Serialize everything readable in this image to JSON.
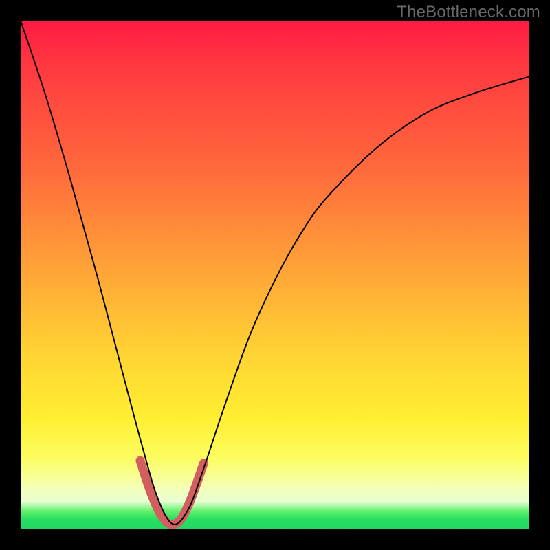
{
  "watermark": "TheBottleneck.com",
  "colors": {
    "frame": "#000000",
    "gradient_top": "#ff1a43",
    "gradient_mid": "#ffd233",
    "gradient_bottom": "#21d863",
    "curve": "#000000",
    "marker": "#d25e60",
    "watermark_text": "#67696a"
  },
  "chart_data": {
    "type": "line",
    "title": "",
    "xlabel": "",
    "ylabel": "",
    "xlim": [
      0,
      1
    ],
    "ylim": [
      0,
      1
    ],
    "notes": "V-shaped bottleneck curve over a vertical red-to-green gradient. x and y are normalized fractions of plot width/height (origin bottom-left). Minimum (optimal point) near x≈0.30 where curve touches y≈0.01. Highlighted marker band near the trough.",
    "series": [
      {
        "name": "bottleneck_curve",
        "x": [
          0.0,
          0.05,
          0.1,
          0.15,
          0.2,
          0.24,
          0.27,
          0.3,
          0.33,
          0.36,
          0.4,
          0.45,
          0.5,
          0.55,
          0.6,
          0.7,
          0.8,
          0.9,
          1.0
        ],
        "y": [
          1.0,
          0.85,
          0.68,
          0.5,
          0.31,
          0.16,
          0.06,
          0.01,
          0.04,
          0.12,
          0.24,
          0.38,
          0.49,
          0.58,
          0.65,
          0.75,
          0.82,
          0.86,
          0.89
        ]
      },
      {
        "name": "highlight_band",
        "x": [
          0.235,
          0.255,
          0.275,
          0.295,
          0.315,
          0.335,
          0.36
        ],
        "y": [
          0.135,
          0.075,
          0.03,
          0.01,
          0.02,
          0.06,
          0.13
        ]
      }
    ]
  }
}
